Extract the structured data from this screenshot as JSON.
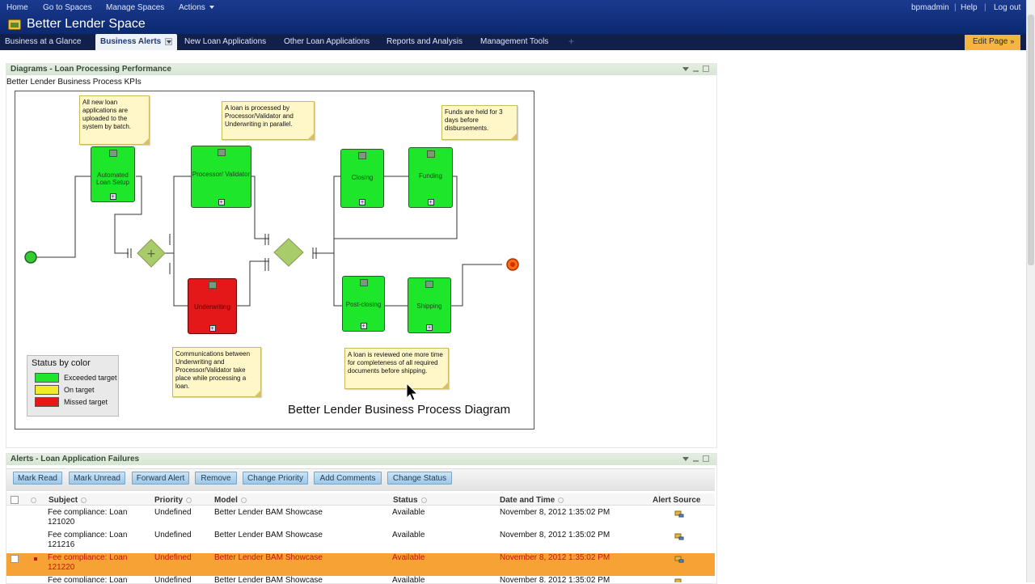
{
  "top_nav": {
    "home": "Home",
    "go_to_spaces": "Go to Spaces",
    "manage_spaces": "Manage Spaces",
    "actions": "Actions",
    "user": "bpmadmin",
    "help": "Help",
    "logout": "Log out",
    "separator": "|"
  },
  "space_title": "Better Lender Space",
  "tabs": [
    {
      "label": "Business at a Glance"
    },
    {
      "label": "Business Alerts"
    },
    {
      "label": "New Loan Applications"
    },
    {
      "label": "Other Loan Applications"
    },
    {
      "label": "Reports and Analysis"
    },
    {
      "label": "Management Tools"
    }
  ],
  "edit_page": "Edit Page",
  "edit_page_chevron": "»",
  "add_tab_symbol": "+",
  "diagram_portlet": {
    "title": "Diagrams - Loan Processing Performance",
    "subtitle": "Better Lender Business Process KPIs",
    "diagram_title": "Better Lender Business Process Diagram",
    "tasks": {
      "automated": "Automated Loan Setup",
      "processor": "Processor/ Validator",
      "underwriting": "Underwriting",
      "closing": "Closing",
      "funding": "Funding",
      "postclosing": "Post-closing",
      "shipping": "Shipping"
    },
    "notes": {
      "n1": "All new loan applications are uploaded to the system by batch.",
      "n2": "A loan is processed by Processor/Validator and Underwriting in parallel.",
      "n3": "Funds are held for 3 days before disbursements.",
      "n4": "Communications between Underwriting and Processor/Validator take place while processing a loan.",
      "n5": "A loan is reviewed one more time for completeness of all required documents before shipping."
    },
    "legend": {
      "title": "Status by color",
      "items": [
        {
          "label": "Exceeded target",
          "color": "#1ee62a"
        },
        {
          "label": "On target",
          "color": "#f0ea2a"
        },
        {
          "label": "Missed target",
          "color": "#e41818"
        }
      ]
    },
    "task_plus": "+"
  },
  "alerts_portlet": {
    "title": "Alerts - Loan Application Failures",
    "buttons": [
      "Mark Read",
      "Mark Unread",
      "Forward Alert",
      "Remove",
      "Change Priority",
      "Add Comments",
      "Change Status"
    ],
    "columns": {
      "subject": "Subject",
      "priority": "Priority",
      "model": "Model",
      "status": "Status",
      "date": "Date and Time",
      "source": "Alert Source"
    },
    "rows": [
      {
        "subject_l1": "Fee compliance: Loan",
        "subject_l2": "121020",
        "priority": "Undefined",
        "model": "Better Lender BAM Showcase",
        "status": "Available",
        "date": "November 8, 2012 1:35:02 PM"
      },
      {
        "subject_l1": "Fee compliance: Loan",
        "subject_l2": "121216",
        "priority": "Undefined",
        "model": "Better Lender BAM Showcase",
        "status": "Available",
        "date": "November 8, 2012 1:35:02 PM"
      },
      {
        "subject_l1": "Fee compliance: Loan",
        "subject_l2": "121220",
        "priority": "Undefined",
        "model": "Better Lender BAM Showcase",
        "status": "Available",
        "date": "November 8, 2012 1:35:02 PM"
      },
      {
        "subject_l1": "Fee compliance: Loan",
        "subject_l2": "",
        "priority": "Undefined",
        "model": "Better Lender BAM Showcase",
        "status": "Available",
        "date": "November 8, 2012 1:35:02 PM"
      }
    ]
  },
  "colors": {
    "header_blue": "#0d2a73",
    "highlight_row": "#f7a234",
    "edit_page": "#f4b640"
  }
}
